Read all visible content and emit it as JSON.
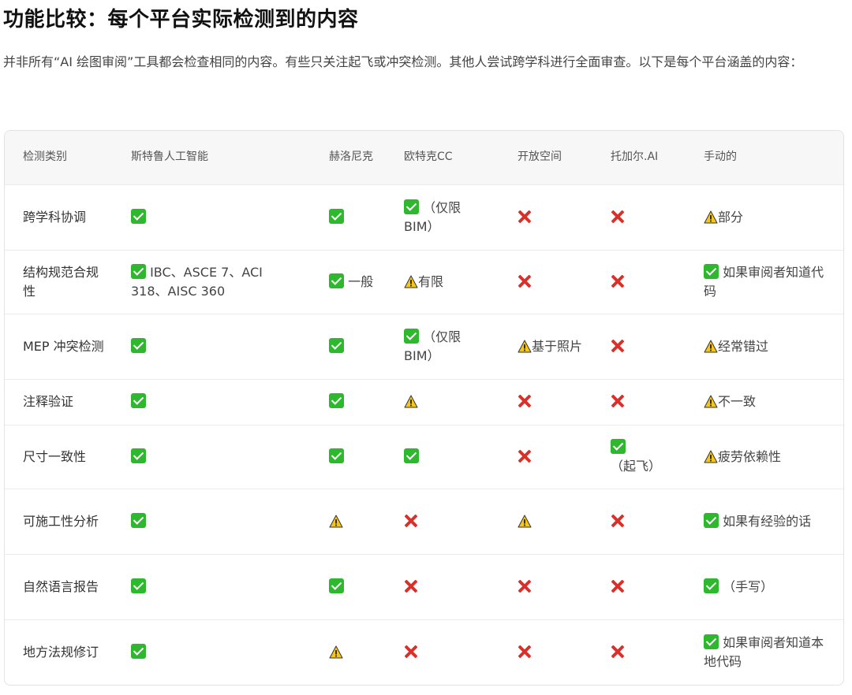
{
  "title": "功能比较：每个平台实际检测到的内容",
  "intro": "并非所有“AI 绘图审阅”工具都会检查相同的内容。有些只关注起飞或冲突检测。其他人尝试跨学科进行全面审查。以下是每个平台涵盖的内容：",
  "table": {
    "headers": [
      "检测类别",
      "斯特鲁人工智能",
      "赫洛尼克",
      "欧特克CC",
      "开放空间",
      "托加尔.AI",
      "手动的"
    ],
    "rows": [
      {
        "label": "跨学科协调",
        "cells": [
          {
            "icon": "check",
            "text": ""
          },
          {
            "icon": "check",
            "text": ""
          },
          {
            "icon": "check",
            "text": "（仅限 BIM）"
          },
          {
            "icon": "cross",
            "text": ""
          },
          {
            "icon": "cross",
            "text": ""
          },
          {
            "icon": "warn",
            "text": "部分"
          }
        ]
      },
      {
        "label": "结构规范合规性",
        "cells": [
          {
            "icon": "check",
            "text": "IBC、ASCE 7、ACI 318、AISC 360"
          },
          {
            "icon": "check",
            "text": "一般"
          },
          {
            "icon": "warn",
            "text": "有限"
          },
          {
            "icon": "cross",
            "text": ""
          },
          {
            "icon": "cross",
            "text": ""
          },
          {
            "icon": "check",
            "text": "如果审阅者知道代码"
          }
        ]
      },
      {
        "label": "MEP 冲突检测",
        "cells": [
          {
            "icon": "check",
            "text": ""
          },
          {
            "icon": "check",
            "text": ""
          },
          {
            "icon": "check",
            "text": "（仅限 BIM）"
          },
          {
            "icon": "warn",
            "text": "基于照片"
          },
          {
            "icon": "cross",
            "text": ""
          },
          {
            "icon": "warn",
            "text": "经常错过"
          }
        ]
      },
      {
        "label": "注释验证",
        "cells": [
          {
            "icon": "check",
            "text": ""
          },
          {
            "icon": "check",
            "text": ""
          },
          {
            "icon": "warn",
            "text": ""
          },
          {
            "icon": "cross",
            "text": ""
          },
          {
            "icon": "cross",
            "text": ""
          },
          {
            "icon": "warn",
            "text": "不一致"
          }
        ]
      },
      {
        "label": "尺寸一致性",
        "cells": [
          {
            "icon": "check",
            "text": ""
          },
          {
            "icon": "check",
            "text": ""
          },
          {
            "icon": "check",
            "text": ""
          },
          {
            "icon": "cross",
            "text": ""
          },
          {
            "icon": "check",
            "text": "（起飞）"
          },
          {
            "icon": "warn",
            "text": "疲劳依赖性"
          }
        ]
      },
      {
        "label": "可施工性分析",
        "cells": [
          {
            "icon": "check",
            "text": ""
          },
          {
            "icon": "warn",
            "text": ""
          },
          {
            "icon": "cross",
            "text": ""
          },
          {
            "icon": "warn",
            "text": ""
          },
          {
            "icon": "cross",
            "text": ""
          },
          {
            "icon": "check",
            "text": "如果有经验的话"
          }
        ]
      },
      {
        "label": "自然语言报告",
        "cells": [
          {
            "icon": "check",
            "text": ""
          },
          {
            "icon": "check",
            "text": ""
          },
          {
            "icon": "cross",
            "text": ""
          },
          {
            "icon": "cross",
            "text": ""
          },
          {
            "icon": "cross",
            "text": ""
          },
          {
            "icon": "check",
            "text": "（手写）"
          }
        ]
      },
      {
        "label": "地方法规修订",
        "cells": [
          {
            "icon": "check",
            "text": ""
          },
          {
            "icon": "warn",
            "text": ""
          },
          {
            "icon": "cross",
            "text": ""
          },
          {
            "icon": "cross",
            "text": ""
          },
          {
            "icon": "cross",
            "text": ""
          },
          {
            "icon": "check",
            "text": "如果审阅者知道本地代码"
          }
        ]
      }
    ]
  },
  "icon_names": {
    "check": "check-icon",
    "cross": "cross-icon",
    "warn": "warning-icon"
  },
  "colors": {
    "check": "#2eb82e",
    "cross": "#d9302a",
    "warn": "#f5c518"
  }
}
